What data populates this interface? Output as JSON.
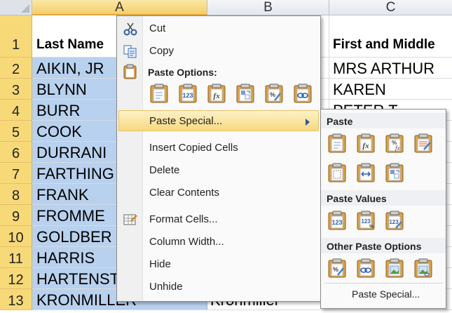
{
  "sheet": {
    "columns": [
      "A",
      "B",
      "C"
    ],
    "rows": [
      {
        "num": "1",
        "a": "Last Name",
        "b": "",
        "c": "First and Middle"
      },
      {
        "num": "2",
        "a": "AIKIN, JR",
        "b": "",
        "c": "MRS ARTHUR"
      },
      {
        "num": "3",
        "a": "BLYNN",
        "b": "",
        "c": "KAREN"
      },
      {
        "num": "4",
        "a": "BURR",
        "b": "",
        "c": "PETER T"
      },
      {
        "num": "5",
        "a": "COOK",
        "b": "",
        "c": ""
      },
      {
        "num": "6",
        "a": "DURRANI",
        "b": "",
        "c": ""
      },
      {
        "num": "7",
        "a": "FARTHING",
        "b": "",
        "c": ""
      },
      {
        "num": "8",
        "a": "FRANK",
        "b": "",
        "c": ""
      },
      {
        "num": "9",
        "a": "FROMME",
        "b": "",
        "c": ""
      },
      {
        "num": "10",
        "a": "GOLDBER",
        "b": "",
        "c": ""
      },
      {
        "num": "11",
        "a": "HARRIS",
        "b": "",
        "c": ""
      },
      {
        "num": "12",
        "a": "HARTENST",
        "b": "",
        "c": ""
      },
      {
        "num": "13",
        "a": "KRONMILLER",
        "b": "Kronmiller",
        "c": ""
      }
    ],
    "selection_color": "#b8d1ee",
    "header_highlight": "#f7d978"
  },
  "context_menu": {
    "cut": "Cut",
    "copy": "Copy",
    "paste_options_header": "Paste Options:",
    "paste_special": "Paste Special...",
    "insert_copied_cells": "Insert Copied Cells",
    "delete": "Delete",
    "clear_contents": "Clear Contents",
    "format_cells": "Format Cells...",
    "column_width": "Column Width...",
    "hide": "Hide",
    "unhide": "Unhide",
    "paste_icons": [
      "paste-icon",
      "values-icon",
      "formulas-icon",
      "transpose-icon",
      "formatting-icon",
      "paste-link-icon"
    ],
    "highlight_color": "#f8d97f"
  },
  "submenu": {
    "paste_header": "Paste",
    "paste_values_header": "Paste Values",
    "other_paste_options_header": "Other Paste Options",
    "paste_special_footer": "Paste Special...",
    "paste_icons": [
      "paste-icon",
      "formulas-icon",
      "formulas-number-format-icon",
      "keep-source-formatting-icon",
      "no-borders-icon",
      "keep-column-widths-icon",
      "transpose-icon"
    ],
    "values_icons": [
      "values-icon",
      "values-number-format-icon",
      "values-source-formatting-icon"
    ],
    "other_icons": [
      "formatting-icon",
      "paste-link-icon",
      "picture-icon",
      "linked-picture-icon"
    ]
  }
}
